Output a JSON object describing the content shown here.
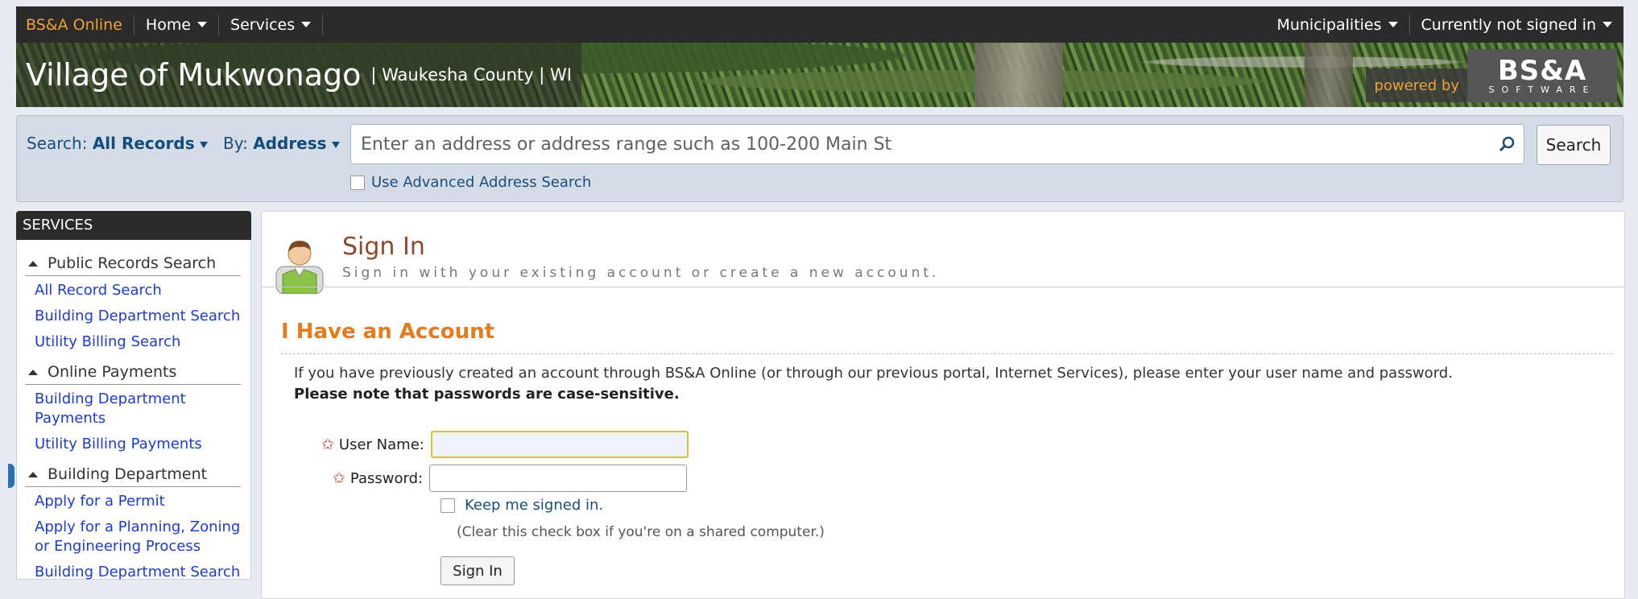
{
  "topnav": {
    "brand": "BS&A Online",
    "home": "Home",
    "services": "Services",
    "municipalities": "Municipalities",
    "signin_status": "Currently not signed in"
  },
  "banner": {
    "village": "Village of Mukwonago",
    "county": "| Waukesha County | WI",
    "powered_by": "powered by",
    "logo_main": "BS&A",
    "logo_sub": "SOFTWARE"
  },
  "search": {
    "search_label": "Search:",
    "search_value": "All Records",
    "by_label": "By:",
    "by_value": "Address",
    "placeholder": "Enter an address or address range such as 100-200 Main St",
    "button": "Search",
    "advanced": "Use Advanced Address Search"
  },
  "sidebar": {
    "header": "SERVICES",
    "sections": [
      {
        "title": "Public Records Search",
        "links": [
          "All Record Search",
          "Building Department Search",
          "Utility Billing Search"
        ]
      },
      {
        "title": "Online Payments",
        "links": [
          "Building Department Payments",
          "Utility Billing Payments"
        ]
      },
      {
        "title": "Building Department",
        "links": [
          "Apply for a Permit",
          "Apply for a Planning, Zoning or Engineering Process",
          "Building Department Search"
        ]
      }
    ]
  },
  "main": {
    "title": "Sign In",
    "subtitle": "Sign in with your existing account or create a new account.",
    "heading": "I Have an Account",
    "info": "If you have previously created an account through BS&A Online (or through our previous portal, Internet Services), please enter your user name and password.",
    "note": "Please note that passwords are case-sensitive.",
    "username_label": "User Name:",
    "password_label": "Password:",
    "keep_signed": "Keep me signed in.",
    "clear_hint": "(Clear this check box if you're on a shared computer.)",
    "signin_button": "Sign In"
  },
  "colors": {
    "accent_orange": "#e87a1e",
    "link_blue": "#1d3ad6",
    "nav_dark": "#2b2b2b"
  }
}
